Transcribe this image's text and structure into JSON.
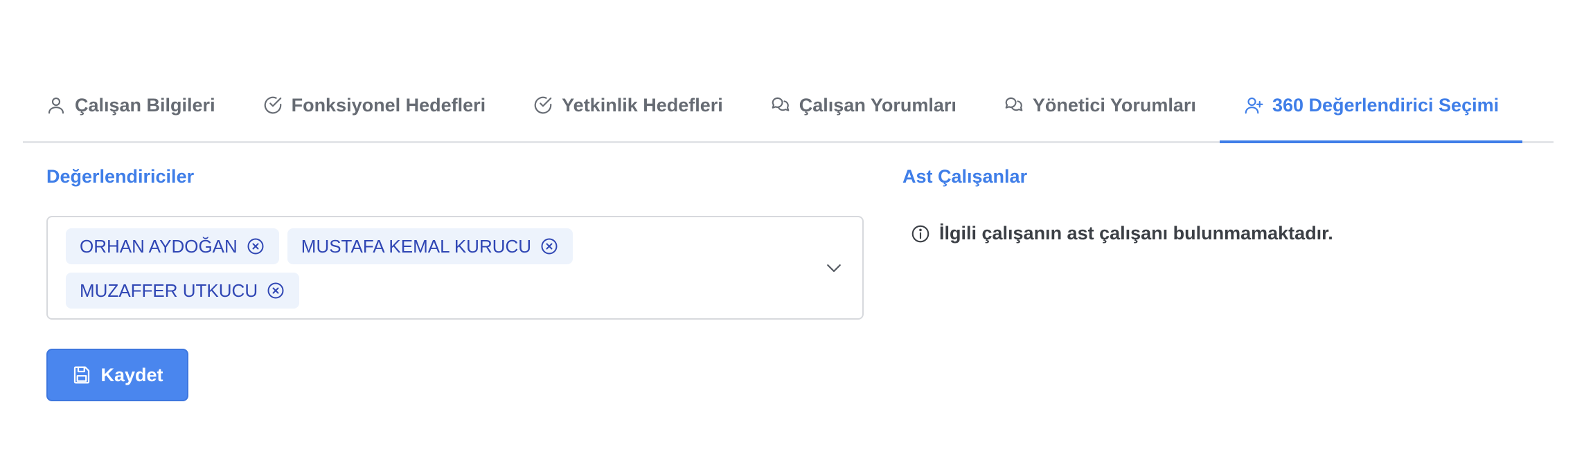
{
  "tabs": [
    {
      "label": "Çalışan Bilgileri",
      "icon": "user-icon",
      "active": false
    },
    {
      "label": "Fonksiyonel Hedefleri",
      "icon": "check-circle-icon",
      "active": false
    },
    {
      "label": "Yetkinlik Hedefleri",
      "icon": "check-circle-icon",
      "active": false
    },
    {
      "label": "Çalışan Yorumları",
      "icon": "comments-icon",
      "active": false
    },
    {
      "label": "Yönetici Yorumları",
      "icon": "comments-icon",
      "active": false
    },
    {
      "label": "360 Değerlendirici Seçimi",
      "icon": "user-plus-icon",
      "active": true
    }
  ],
  "evaluators": {
    "title": "Değerlendiriciler",
    "selected": [
      "ORHAN AYDOĞAN",
      "MUSTAFA KEMAL KURUCU",
      "MUZAFFER UTKUCU"
    ]
  },
  "subordinates": {
    "title": "Ast Çalışanlar",
    "empty_message": "İlgili çalışanın ast çalışanı bulunmamaktadır."
  },
  "actions": {
    "save_label": "Kaydet"
  },
  "colors": {
    "accent": "#3f7ee8",
    "chip_bg": "#edf3fc",
    "chip_text": "#2f46b4",
    "button_bg": "#4a86ee",
    "tab_text": "#666b73"
  }
}
